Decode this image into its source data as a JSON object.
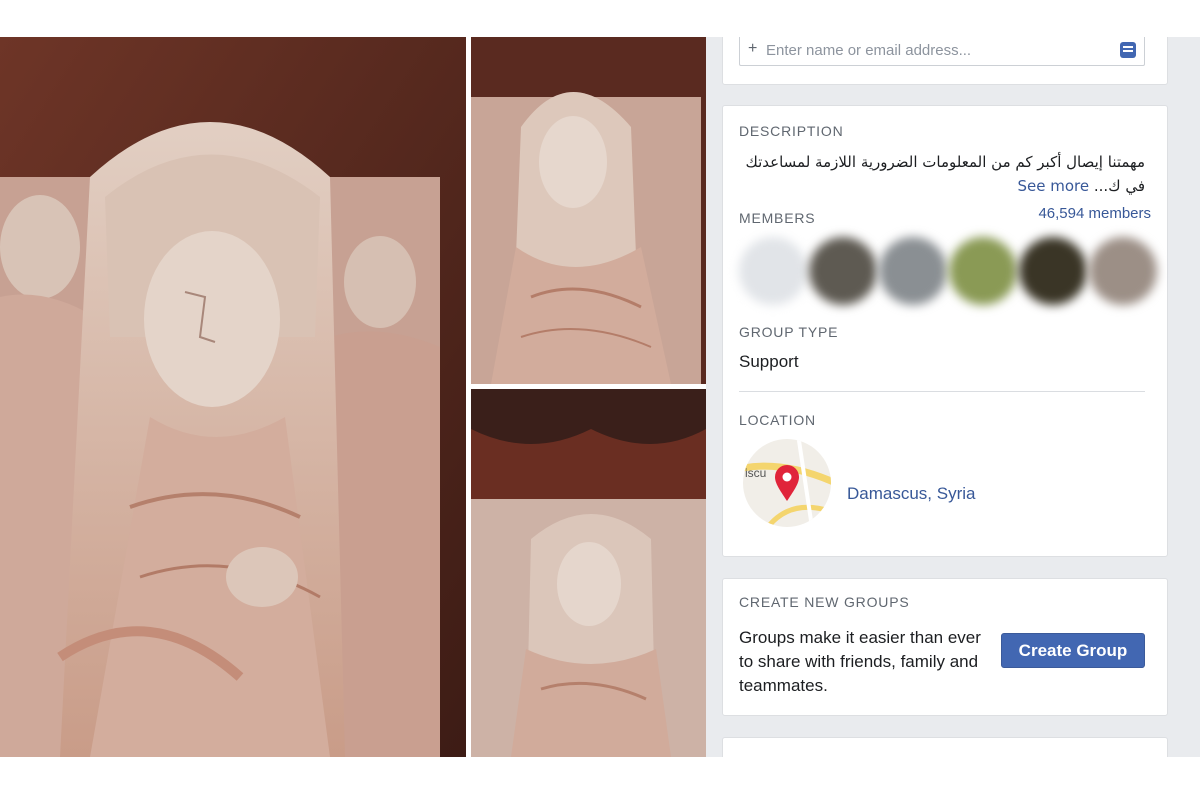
{
  "invite": {
    "placeholder": "Enter name or email address...",
    "plus_icon": "plus-icon",
    "contacts_icon": "contacts-icon"
  },
  "about": {
    "description_label": "DESCRIPTION",
    "description_text": "مهمتنا إيصال أكبر كم من المعلومات الضرورية اللازمة لمساعدتك في ك...",
    "see_more": "See more",
    "members_label": "MEMBERS",
    "members_count": "46,594 members",
    "group_type_label": "GROUP TYPE",
    "group_type_value": "Support",
    "location_label": "LOCATION",
    "location_city": "Damascus, Syria",
    "map_pin_icon": "map-pin-icon"
  },
  "create_groups": {
    "label": "CREATE NEW GROUPS",
    "text": "Groups make it easier than ever to share with friends, family and teammates.",
    "button": "Create Group"
  },
  "colors": {
    "link": "#385898",
    "button": "#4267b2",
    "page_background": "#e9ebee",
    "map_pin": "#e0243a"
  }
}
